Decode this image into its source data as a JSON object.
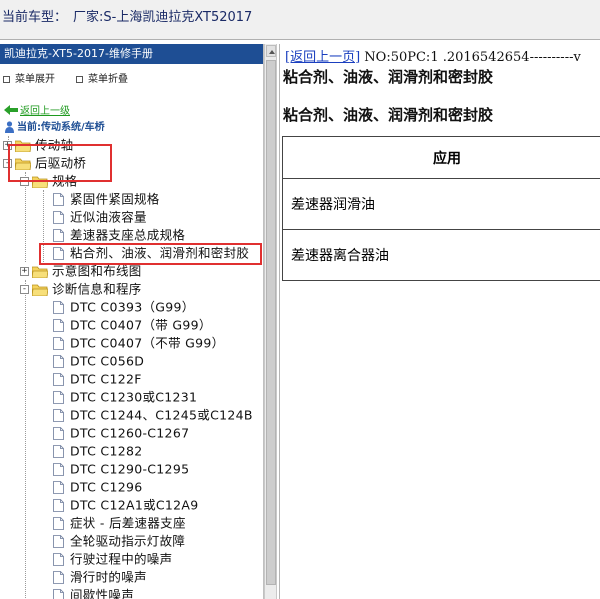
{
  "topbar": {
    "label": "当前车型：",
    "vehicle": "厂家:S-上海凯迪拉克XT52017"
  },
  "left": {
    "manual_title": "凯迪拉克-XT5-2017-维修手册",
    "expand_label": "菜单展开",
    "collapse_label": "菜单折叠",
    "back_label": "返回上一级",
    "current_label": "当前:传动系统/车桥",
    "tree": [
      {
        "id": "drive-shaft",
        "label": "传动轴",
        "type": "folder",
        "toggle": "+"
      },
      {
        "id": "rear-axle",
        "label": "后驱动桥",
        "type": "folder",
        "toggle": "-"
      },
      {
        "id": "specs",
        "label": "规格",
        "type": "folder",
        "toggle": "-"
      },
      {
        "id": "fastener",
        "label": "紧固件紧固规格",
        "type": "doc"
      },
      {
        "id": "capacity",
        "label": "近似油液容量",
        "type": "doc"
      },
      {
        "id": "diff-mount",
        "label": "差速器支座总成规格",
        "type": "doc"
      },
      {
        "id": "sealants",
        "label": "粘合剂、油液、润滑剂和密封胶",
        "type": "doc"
      },
      {
        "id": "schematics",
        "label": "示意图和布线图",
        "type": "folder",
        "toggle": "+"
      },
      {
        "id": "diagnostics",
        "label": "诊断信息和程序",
        "type": "folder",
        "toggle": "-"
      },
      {
        "id": "dtc-1",
        "label": "DTC C0393（G99）",
        "type": "doc"
      },
      {
        "id": "dtc-2",
        "label": "DTC C0407（带 G99）",
        "type": "doc"
      },
      {
        "id": "dtc-3",
        "label": "DTC C0407（不带 G99）",
        "type": "doc"
      },
      {
        "id": "dtc-4",
        "label": "DTC C056D",
        "type": "doc"
      },
      {
        "id": "dtc-5",
        "label": "DTC C122F",
        "type": "doc"
      },
      {
        "id": "dtc-6",
        "label": "DTC C1230或C1231",
        "type": "doc"
      },
      {
        "id": "dtc-7",
        "label": "DTC C1244、C1245或C124B",
        "type": "doc"
      },
      {
        "id": "dtc-8",
        "label": "DTC C1260-C1267",
        "type": "doc"
      },
      {
        "id": "dtc-9",
        "label": "DTC C1282",
        "type": "doc"
      },
      {
        "id": "dtc-10",
        "label": "DTC C1290-C1295",
        "type": "doc"
      },
      {
        "id": "dtc-11",
        "label": "DTC C1296",
        "type": "doc"
      },
      {
        "id": "dtc-12",
        "label": "DTC C12A1或C12A9",
        "type": "doc"
      },
      {
        "id": "symptom",
        "label": "症状 - 后差速器支座",
        "type": "doc"
      },
      {
        "id": "awd-lamp",
        "label": "全轮驱动指示灯故障",
        "type": "doc"
      },
      {
        "id": "driving-noise",
        "label": "行驶过程中的噪声",
        "type": "doc"
      },
      {
        "id": "coast-noise",
        "label": "滑行时的噪声",
        "type": "doc"
      },
      {
        "id": "intermittent",
        "label": "间歇性噪声",
        "type": "doc"
      }
    ]
  },
  "right": {
    "back_link": "[返回上一页]",
    "doc_info": " NO:50PC:1 .2016542654----------v",
    "title_1": "粘合剂、油液、润滑剂和密封胶",
    "title_2": "粘合剂、油液、润滑剂和密封胶",
    "table_header": "应用",
    "rows": [
      "差速器润滑油",
      "差速器离合器油"
    ]
  },
  "colors": {
    "header_blue": "#1e4e94",
    "highlight_red": "#e03030",
    "link_blue": "#1a3fbf",
    "back_green": "#1f9a1f"
  }
}
